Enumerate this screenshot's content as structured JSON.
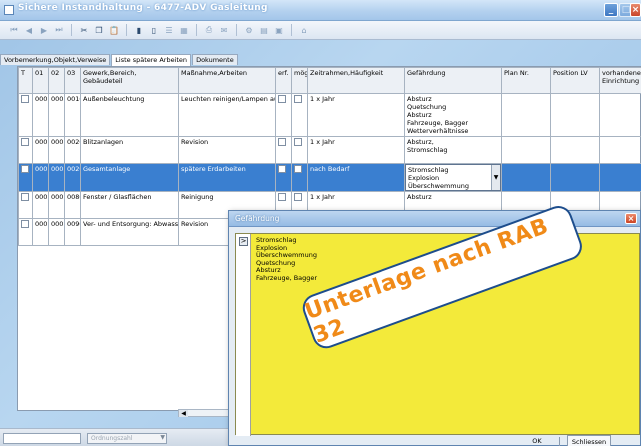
{
  "window": {
    "title": "Sichere Instandhaltung  -  6477-ADV  Gasleitung"
  },
  "tabs": [
    {
      "label": "Vorbemerkung,Objekt,Verweise"
    },
    {
      "label": "Liste spätere Arbeiten"
    },
    {
      "label": "Dokumente"
    }
  ],
  "grid": {
    "headers": [
      "T",
      "01",
      "02",
      "03",
      "Gewerk,Bereich, Gebäudeteil",
      "Maßnahme,Arbeiten",
      "erf.",
      "mög.",
      "Zeitrahmen,Häufigkeit",
      "Gefährdung",
      "Plan Nr.",
      "Position LV",
      "vorhandene Einrichtung"
    ],
    "rows": [
      {
        "c01": "000",
        "c02": "000",
        "c03": "0010",
        "gewerk": "Außenbeleuchtung",
        "massnahme": "Leuchten reinigen/Lampen au",
        "zeit": "1 x Jahr",
        "gef1": "Absturz",
        "gef2": "Quetschung",
        "gef3": "Absturz",
        "gef4": "Fahrzeuge, Bagger",
        "gef5": "Wetterverhältnisse"
      },
      {
        "c01": "000",
        "c02": "000",
        "c03": "0020",
        "gewerk": "Blitzanlagen",
        "massnahme": "Revision",
        "zeit": "1 x Jahr",
        "gef1": "Absturz,",
        "gef2": "Stromschlag"
      },
      {
        "c01": "000",
        "c02": "000",
        "c03": "0020",
        "gewerk": "Gesamtanlage",
        "massnahme": "spätere Erdarbeiten",
        "zeit": "nach Bedarf",
        "gef1": "Stromschlag",
        "gef2": "Explosion",
        "gef3": "Überschwemmung"
      },
      {
        "c01": "000",
        "c02": "000",
        "c03": "0080",
        "gewerk": "Fenster / Glasflächen",
        "massnahme": "Reinigung",
        "zeit": "1 x Jahr",
        "gef1": "Absturz"
      },
      {
        "c01": "000",
        "c02": "000",
        "c03": "0090",
        "gewerk": "Ver- und Entsorgung: Abwasse",
        "massnahme": "Revision",
        "zeit": "",
        "gef1": ""
      }
    ]
  },
  "bottom": {
    "sort_placeholder": "Ordnungszahl"
  },
  "dialog": {
    "title": "Gefährdung",
    "marker": ">",
    "items": [
      "Stromschlag",
      "Explosion",
      "Überschwemmung",
      "Quetschung",
      "Absturz",
      "Fahrzeuge, Bagger"
    ],
    "ok_label": "OK",
    "close_label": "Schliessen"
  },
  "stamp": {
    "text": "Unterlage nach RAB 32"
  },
  "colors": {
    "selected_row": "#3a7fd0",
    "dialog_body": "#f3ea3a",
    "stamp_text": "#f08a18"
  }
}
